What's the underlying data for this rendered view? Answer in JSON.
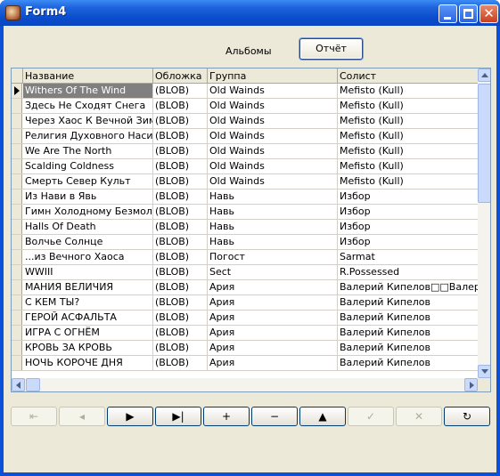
{
  "window": {
    "title": "Form4"
  },
  "form": {
    "albums_label": "Альбомы",
    "report_button": "Отчёт"
  },
  "grid": {
    "columns": [
      "Название",
      "Обложка",
      "Группа",
      "Солист"
    ],
    "rows": [
      [
        "Withers Of The Wind",
        "(BLOB)",
        "Old Wainds",
        "Mefisto (Kull)"
      ],
      [
        "Здесь Не Сходят Снега",
        "(BLOB)",
        "Old Wainds",
        "Mefisto (Kull)"
      ],
      [
        "Через Хаос К Вечной Зиме",
        "(BLOB)",
        "Old Wainds",
        "Mefisto (Kull)"
      ],
      [
        "Религия Духовного Насилия",
        "(BLOB)",
        "Old Wainds",
        "Mefisto (Kull)"
      ],
      [
        "We Are The North",
        "(BLOB)",
        "Old Wainds",
        "Mefisto (Kull)"
      ],
      [
        "Scalding Coldness",
        "(BLOB)",
        "Old Wainds",
        "Mefisto (Kull)"
      ],
      [
        "Смерть Север Культ",
        "(BLOB)",
        "Old Wainds",
        "Mefisto (Kull)"
      ],
      [
        "Из Нави в Явь",
        "(BLOB)",
        "Навь",
        "Избор"
      ],
      [
        "Гимн Холодному Безмолвию",
        "(BLOB)",
        "Навь",
        "Избор"
      ],
      [
        "Halls Of Death",
        "(BLOB)",
        "Навь",
        "Избор"
      ],
      [
        "Волчье Солнце",
        "(BLOB)",
        "Навь",
        "Избор"
      ],
      [
        "...из Вечного Хаоса",
        "(BLOB)",
        "Погост",
        "Sarmat"
      ],
      [
        "WWIII",
        "(BLOB)",
        "Sect",
        "R.Possessed"
      ],
      [
        "МАНИЯ ВЕЛИЧИЯ",
        "(BLOB)",
        "Ария",
        "Валерий Кипелов□□Валерий Ки"
      ],
      [
        "С КЕМ ТЫ?",
        "(BLOB)",
        "Ария",
        "Валерий Кипелов"
      ],
      [
        "ГЕРОЙ АСФАЛЬТА",
        "(BLOB)",
        "Ария",
        "Валерий Кипелов"
      ],
      [
        "ИГРА С ОГНЁМ",
        "(BLOB)",
        "Ария",
        "Валерий Кипелов"
      ],
      [
        "КРОВЬ ЗА КРОВЬ",
        "(BLOB)",
        "Ария",
        "Валерий Кипелов"
      ],
      [
        "НОЧЬ КОРОЧЕ ДНЯ",
        "(BLOB)",
        "Ария",
        "Валерий Кипелов"
      ]
    ],
    "active_row": 0
  },
  "navigator": {
    "buttons": [
      {
        "name": "first-record-button",
        "glyph": "⇤",
        "enabled": false
      },
      {
        "name": "prior-record-button",
        "glyph": "◂",
        "enabled": false
      },
      {
        "name": "next-record-button",
        "glyph": "▶",
        "enabled": true
      },
      {
        "name": "last-record-button",
        "glyph": "▶|",
        "enabled": true
      },
      {
        "name": "insert-record-button",
        "glyph": "+",
        "enabled": true
      },
      {
        "name": "delete-record-button",
        "glyph": "−",
        "enabled": true
      },
      {
        "name": "edit-record-button",
        "glyph": "▲",
        "enabled": true
      },
      {
        "name": "post-record-button",
        "glyph": "✓",
        "enabled": false
      },
      {
        "name": "cancel-record-button",
        "glyph": "✕",
        "enabled": false
      },
      {
        "name": "refresh-record-button",
        "glyph": "↻",
        "enabled": true
      }
    ]
  }
}
